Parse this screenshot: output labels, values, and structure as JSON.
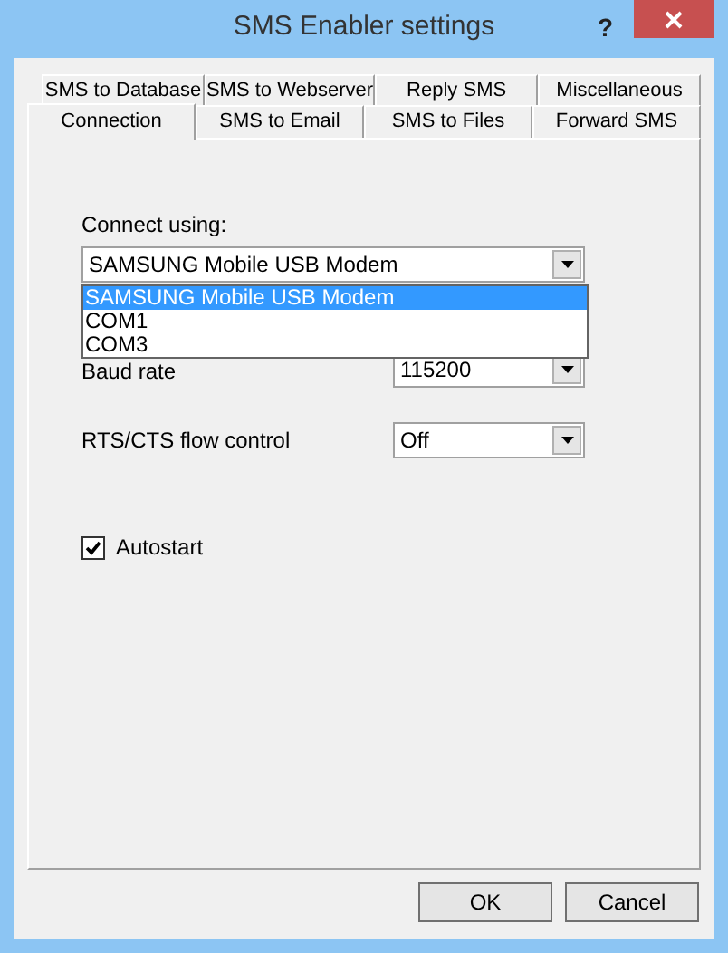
{
  "window": {
    "title": "SMS Enabler settings",
    "help_button": "?"
  },
  "tab_rows": [
    {
      "tabs": [
        {
          "label": "SMS to Database",
          "selected": false
        },
        {
          "label": "SMS to Webserver",
          "selected": false
        },
        {
          "label": "Reply SMS",
          "selected": false
        },
        {
          "label": "Miscellaneous",
          "selected": false
        }
      ]
    },
    {
      "tabs": [
        {
          "label": "Connection",
          "selected": true
        },
        {
          "label": "SMS to Email",
          "selected": false
        },
        {
          "label": "SMS to Files",
          "selected": false
        },
        {
          "label": "Forward SMS",
          "selected": false
        }
      ]
    }
  ],
  "connect_using": {
    "label": "Connect using:",
    "value": "SAMSUNG Mobile USB Modem",
    "expanded": true,
    "options": [
      {
        "label": "SAMSUNG Mobile USB Modem",
        "selected": true
      },
      {
        "label": "COM1",
        "selected": false
      },
      {
        "label": "COM3",
        "selected": false
      }
    ]
  },
  "baud_rate": {
    "label": "Baud rate",
    "value": "115200"
  },
  "flow_control": {
    "label": "RTS/CTS flow control",
    "value": "Off"
  },
  "autostart": {
    "label": "Autostart",
    "checked": true
  },
  "buttons": [
    "OK",
    "Cancel"
  ]
}
